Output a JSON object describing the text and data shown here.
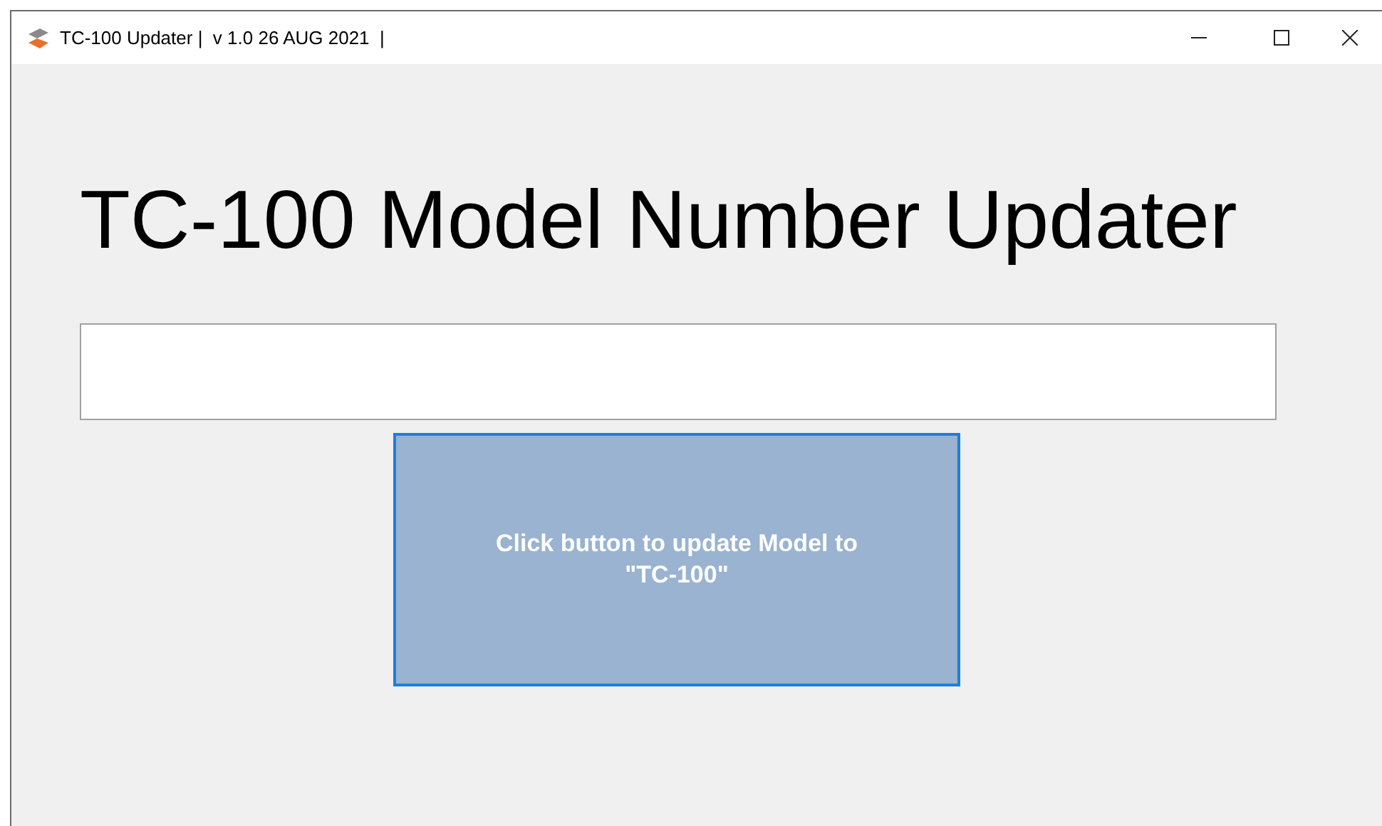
{
  "window": {
    "title": "TC-100 Updater |  v 1.0 26 AUG 2021  |"
  },
  "heading": "TC-100 Model Number Updater",
  "update_button": {
    "label": "Click button to update Model to \"TC-100\""
  }
}
